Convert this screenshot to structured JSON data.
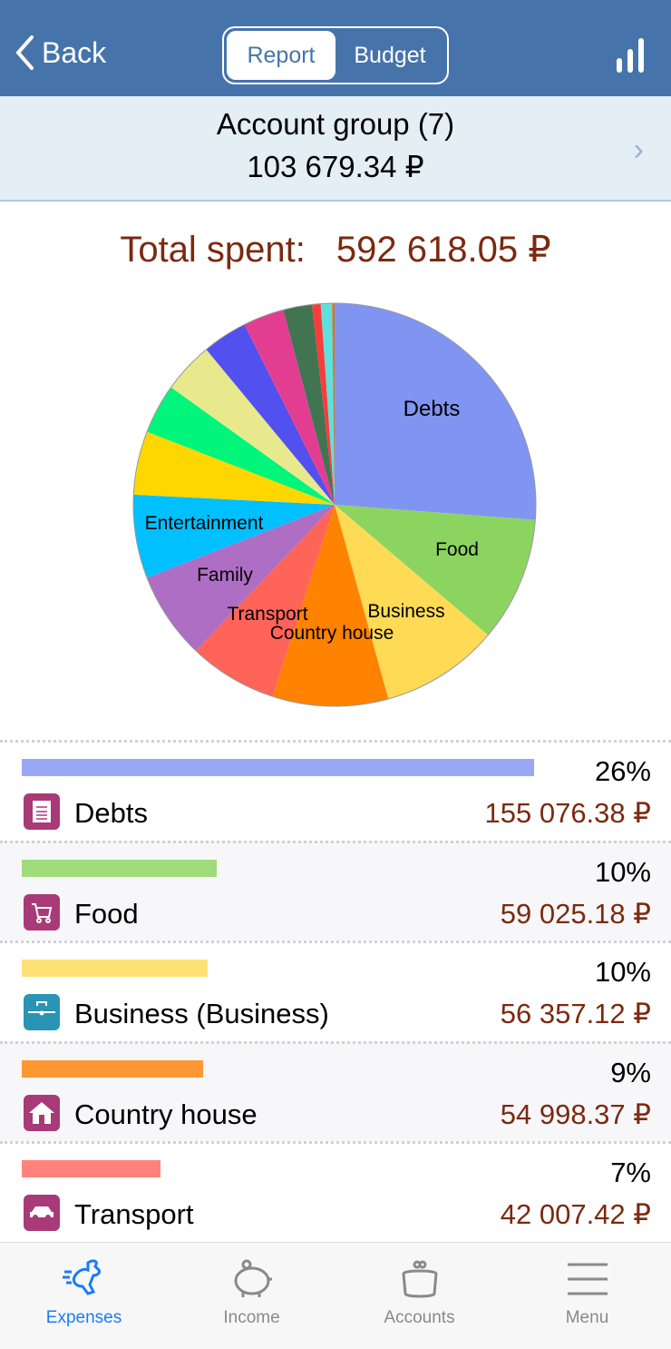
{
  "nav": {
    "back_label": "Back",
    "segments": [
      "Report",
      "Budget"
    ],
    "selected": "Report",
    "stats_icon": "bar-chart-icon"
  },
  "account": {
    "title": "Account group (7)",
    "balance": "103 679.34 ₽"
  },
  "total": {
    "label": "Total spent:",
    "value": "592 618.05 ₽"
  },
  "chart_data": {
    "type": "pie",
    "unit": "percent",
    "slices": [
      {
        "label": "Debts",
        "value": 26.2,
        "color": "#8094f2"
      },
      {
        "label": "Food",
        "value": 10.0,
        "color": "#8cd460"
      },
      {
        "label": "Business",
        "value": 9.5,
        "color": "#ffda55"
      },
      {
        "label": "Country house",
        "value": 9.3,
        "color": "#ff8200"
      },
      {
        "label": "Transport",
        "value": 7.1,
        "color": "#ff6459"
      },
      {
        "label": "Family",
        "value": 7.0,
        "color": "#ae6ec4"
      },
      {
        "label": "Entertainment",
        "value": 6.7,
        "color": "#00c0ff"
      },
      {
        "value": 5.1,
        "color": "#ffd700"
      },
      {
        "value": 4.0,
        "color": "#00f57a"
      },
      {
        "value": 4.1,
        "color": "#e8e88c"
      },
      {
        "value": 3.6,
        "color": "#5250ee"
      },
      {
        "value": 3.3,
        "color": "#e33d92"
      },
      {
        "value": 2.3,
        "color": "#417552"
      },
      {
        "value": 0.7,
        "color": "#f73c3c"
      },
      {
        "value": 0.9,
        "color": "#5fe0dc"
      },
      {
        "value": 0.2,
        "color": "#d47a1f"
      }
    ]
  },
  "categories": [
    {
      "name": "Debts",
      "percent": "26%",
      "amount": "155 076.38 ₽",
      "value": 155076.38,
      "bar_color": "#99a8f4",
      "icon": "document-icon",
      "icon_color": "#a83a78"
    },
    {
      "name": "Food",
      "percent": "10%",
      "amount": "59 025.18 ₽",
      "value": 59025.18,
      "bar_color": "#a0dc7c",
      "icon": "cart-icon",
      "icon_color": "#a83a78"
    },
    {
      "name": "Business (Business)",
      "percent": "10%",
      "amount": "56 357.12 ₽",
      "value": 56357.12,
      "bar_color": "#ffe077",
      "icon": "briefcase-icon",
      "icon_color": "#2a94b5"
    },
    {
      "name": "Country house",
      "percent": "9%",
      "amount": "54 998.37 ₽",
      "value": 54998.37,
      "bar_color": "#ff9833",
      "icon": "house-icon",
      "icon_color": "#a83a78"
    },
    {
      "name": "Transport",
      "percent": "7%",
      "amount": "42 007.42 ₽",
      "value": 42007.42,
      "bar_color": "#ff837a",
      "icon": "car-icon",
      "icon_color": "#a83a78"
    }
  ],
  "tabs": [
    {
      "label": "Expenses",
      "icon": "rabbit-icon",
      "active": true
    },
    {
      "label": "Income",
      "icon": "piggy-bank-icon"
    },
    {
      "label": "Accounts",
      "icon": "wallet-icon"
    },
    {
      "label": "Menu",
      "icon": "menu-icon"
    }
  ]
}
